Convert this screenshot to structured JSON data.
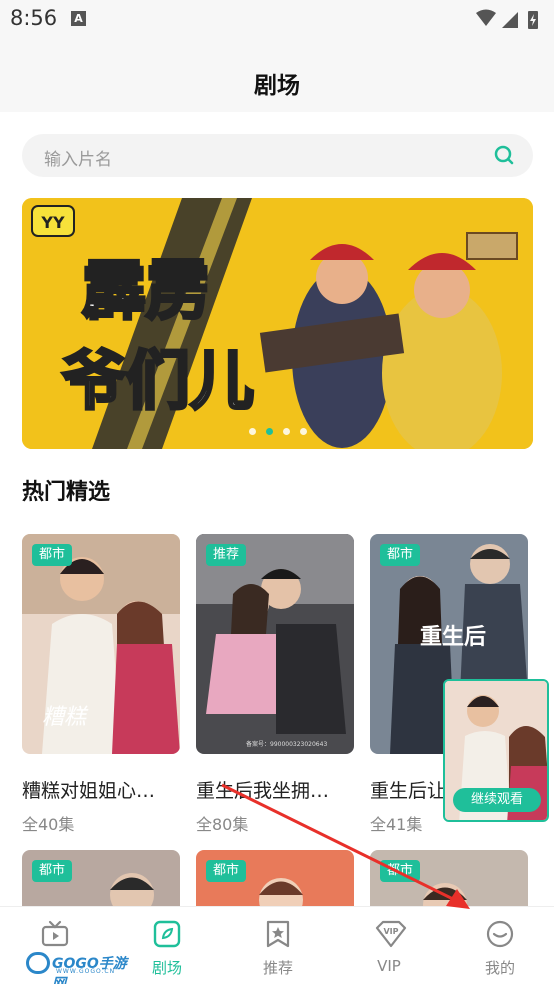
{
  "status_bar": {
    "time": "8:56",
    "notif_letter": "A"
  },
  "header": {
    "title": "剧场"
  },
  "search": {
    "placeholder": "输入片名"
  },
  "banner": {
    "badge": "YY",
    "title_text": "霹雳爷们儿",
    "dots": 4,
    "active_dot": 1
  },
  "section": {
    "title": "热门精选"
  },
  "cards": [
    {
      "tag": "都市",
      "title": "糟糕对姐姐心…",
      "episodes": "全40集"
    },
    {
      "tag": "推荐",
      "title": "重生后我坐拥…",
      "episodes": "全80集"
    },
    {
      "tag": "都市",
      "title": "重生后让",
      "episodes": "全41集"
    }
  ],
  "second_row": [
    {
      "tag": "都市"
    },
    {
      "tag": "都市"
    },
    {
      "tag": "都市"
    }
  ],
  "continue_watch": {
    "label": "继续观看"
  },
  "tabs": [
    {
      "label": "",
      "icon": "tv-icon"
    },
    {
      "label": "剧场",
      "icon": "theater-icon"
    },
    {
      "label": "推荐",
      "icon": "star-bookmark-icon"
    },
    {
      "label": "VIP",
      "icon": "vip-diamond-icon"
    },
    {
      "label": "我的",
      "icon": "smile-icon"
    }
  ],
  "active_tab": 1,
  "watermark": {
    "text": "GOGO手游网",
    "url": "WWW.GOGO.CN"
  },
  "colors": {
    "accent": "#1fbf9a",
    "banner_yellow": "#f2c21b",
    "arrow": "#e8302a"
  }
}
